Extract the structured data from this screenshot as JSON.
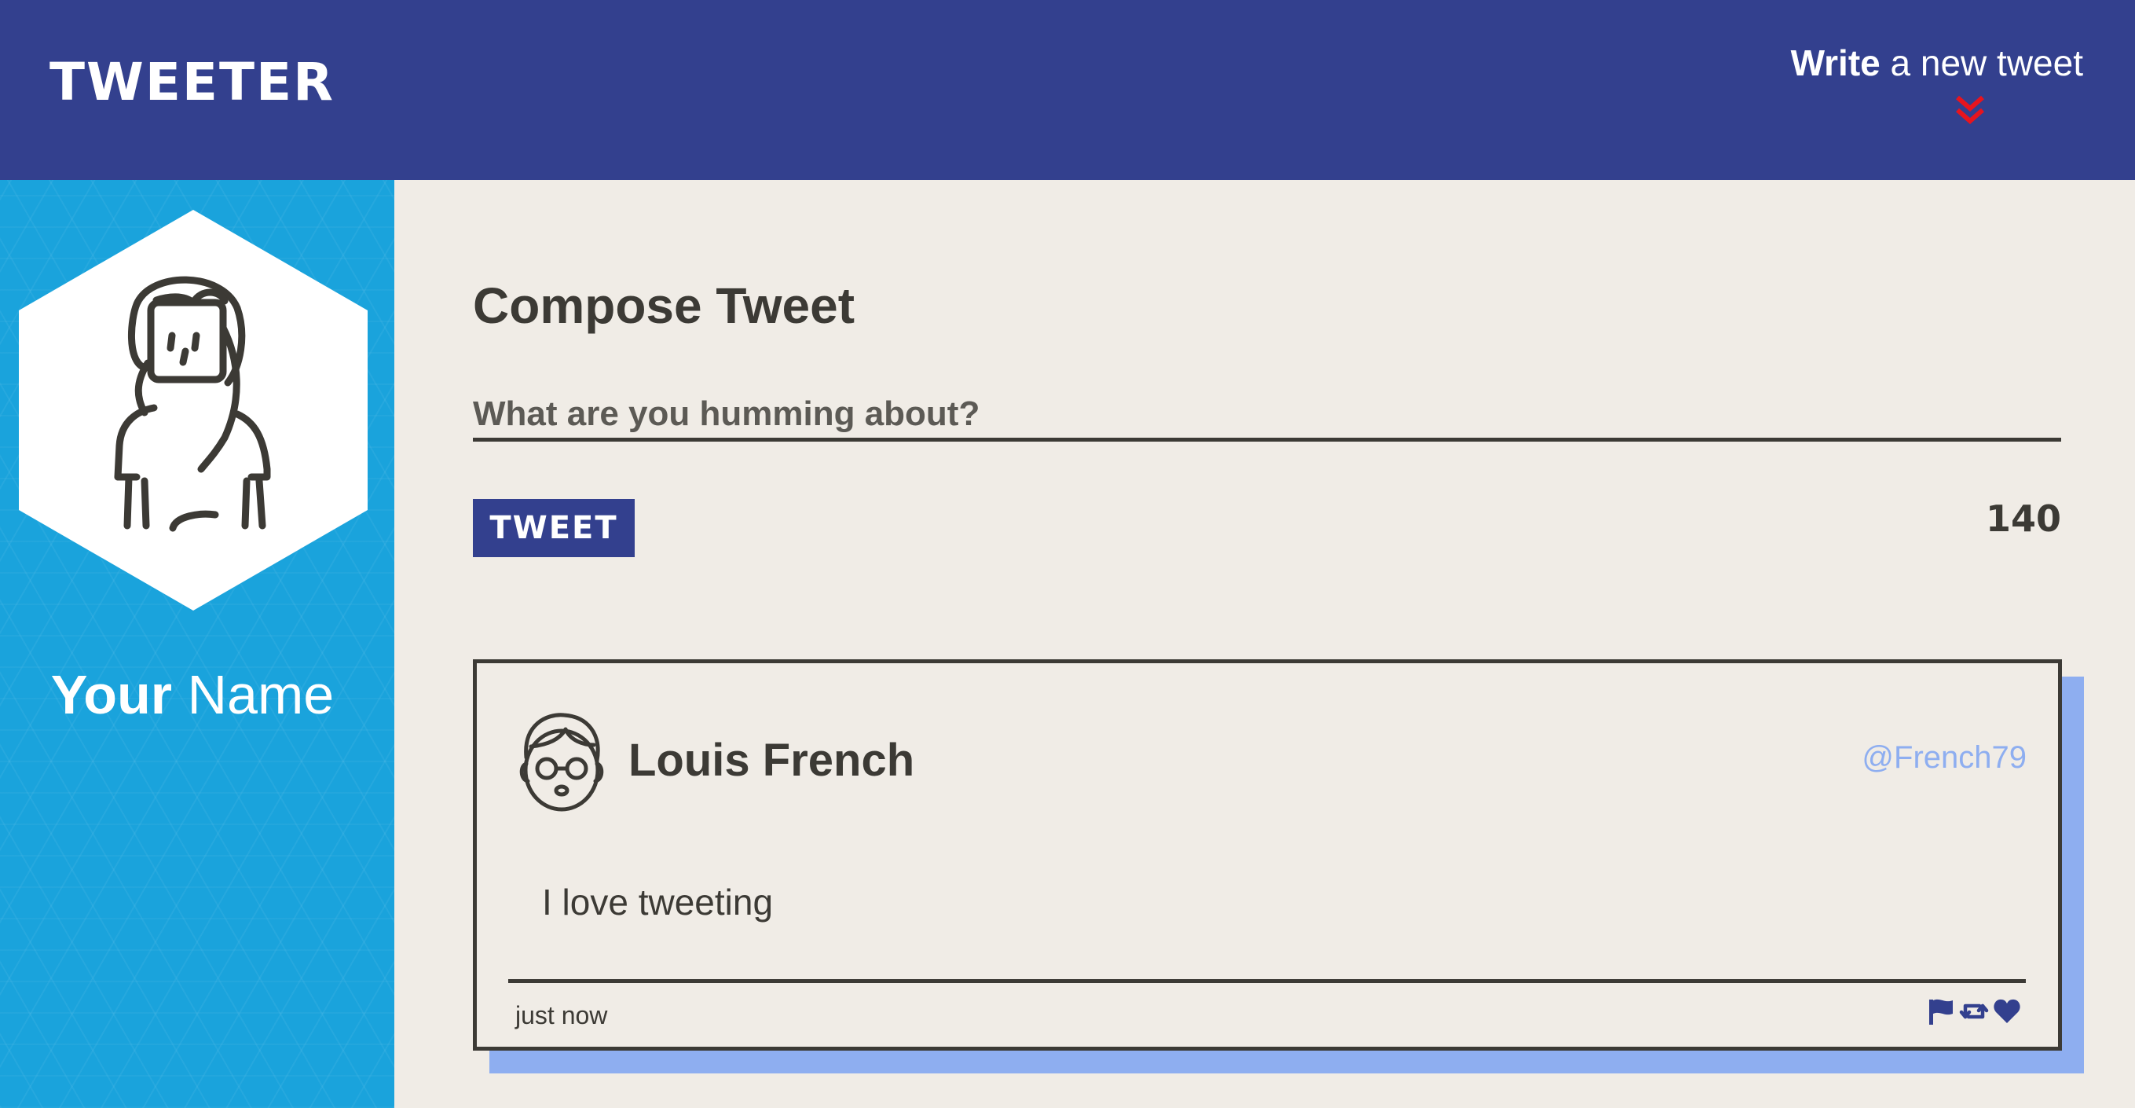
{
  "header": {
    "logo": "TWEETER",
    "compose_toggle": {
      "bold": "Write",
      "rest": " a new tweet"
    }
  },
  "sidebar": {
    "user_name_first": "Your",
    "user_name_last": "Name"
  },
  "compose": {
    "title": "Compose Tweet",
    "placeholder": "What are you humming about?",
    "value": "",
    "button_label": "TWEET",
    "char_count": "140"
  },
  "tweets": [
    {
      "author": "Louis French",
      "handle": "@French79",
      "body": "I love tweeting",
      "time": "just now",
      "actions": [
        "flag-icon",
        "retweet-icon",
        "heart-icon"
      ]
    }
  ],
  "colors": {
    "header_bg": "#33408e",
    "sidebar_bg": "#1aa3dc",
    "page_bg": "#f0ece6",
    "accent_red": "#e8141e",
    "handle_blue": "#8eaef0",
    "text_dark": "#3c3a35"
  }
}
